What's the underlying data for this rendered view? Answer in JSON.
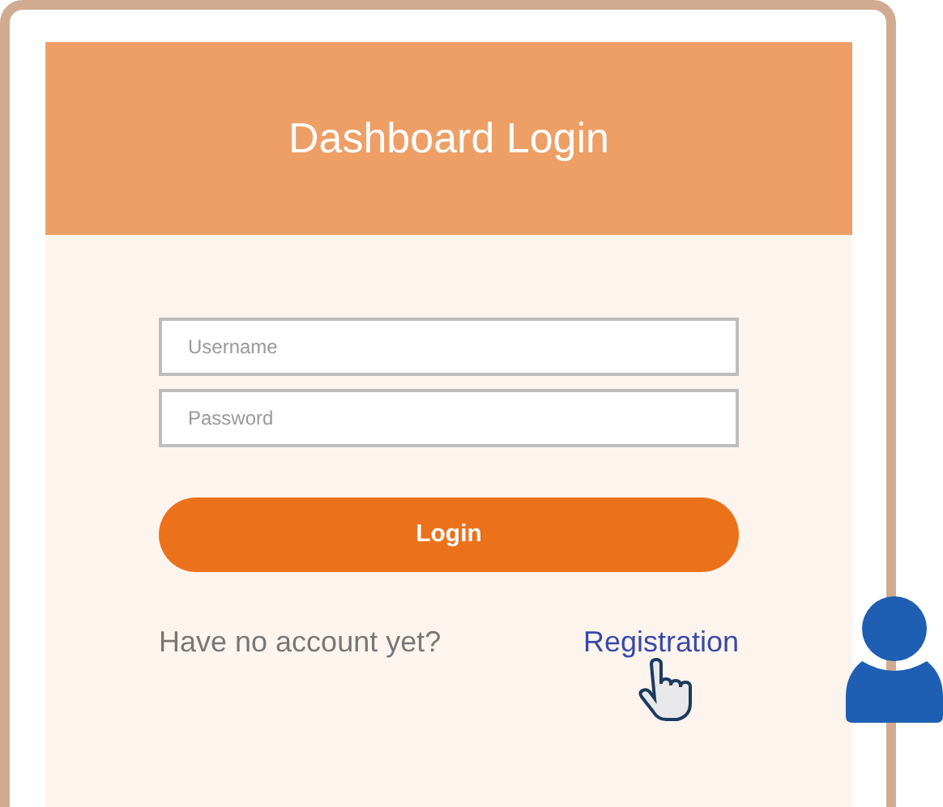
{
  "title": "Dashboard Login",
  "fields": [
    {
      "placeholder": "Username"
    },
    {
      "placeholder": "Password"
    }
  ],
  "login_button": "Login",
  "prompt": "Have no account yet?",
  "register_link": "Registration"
}
